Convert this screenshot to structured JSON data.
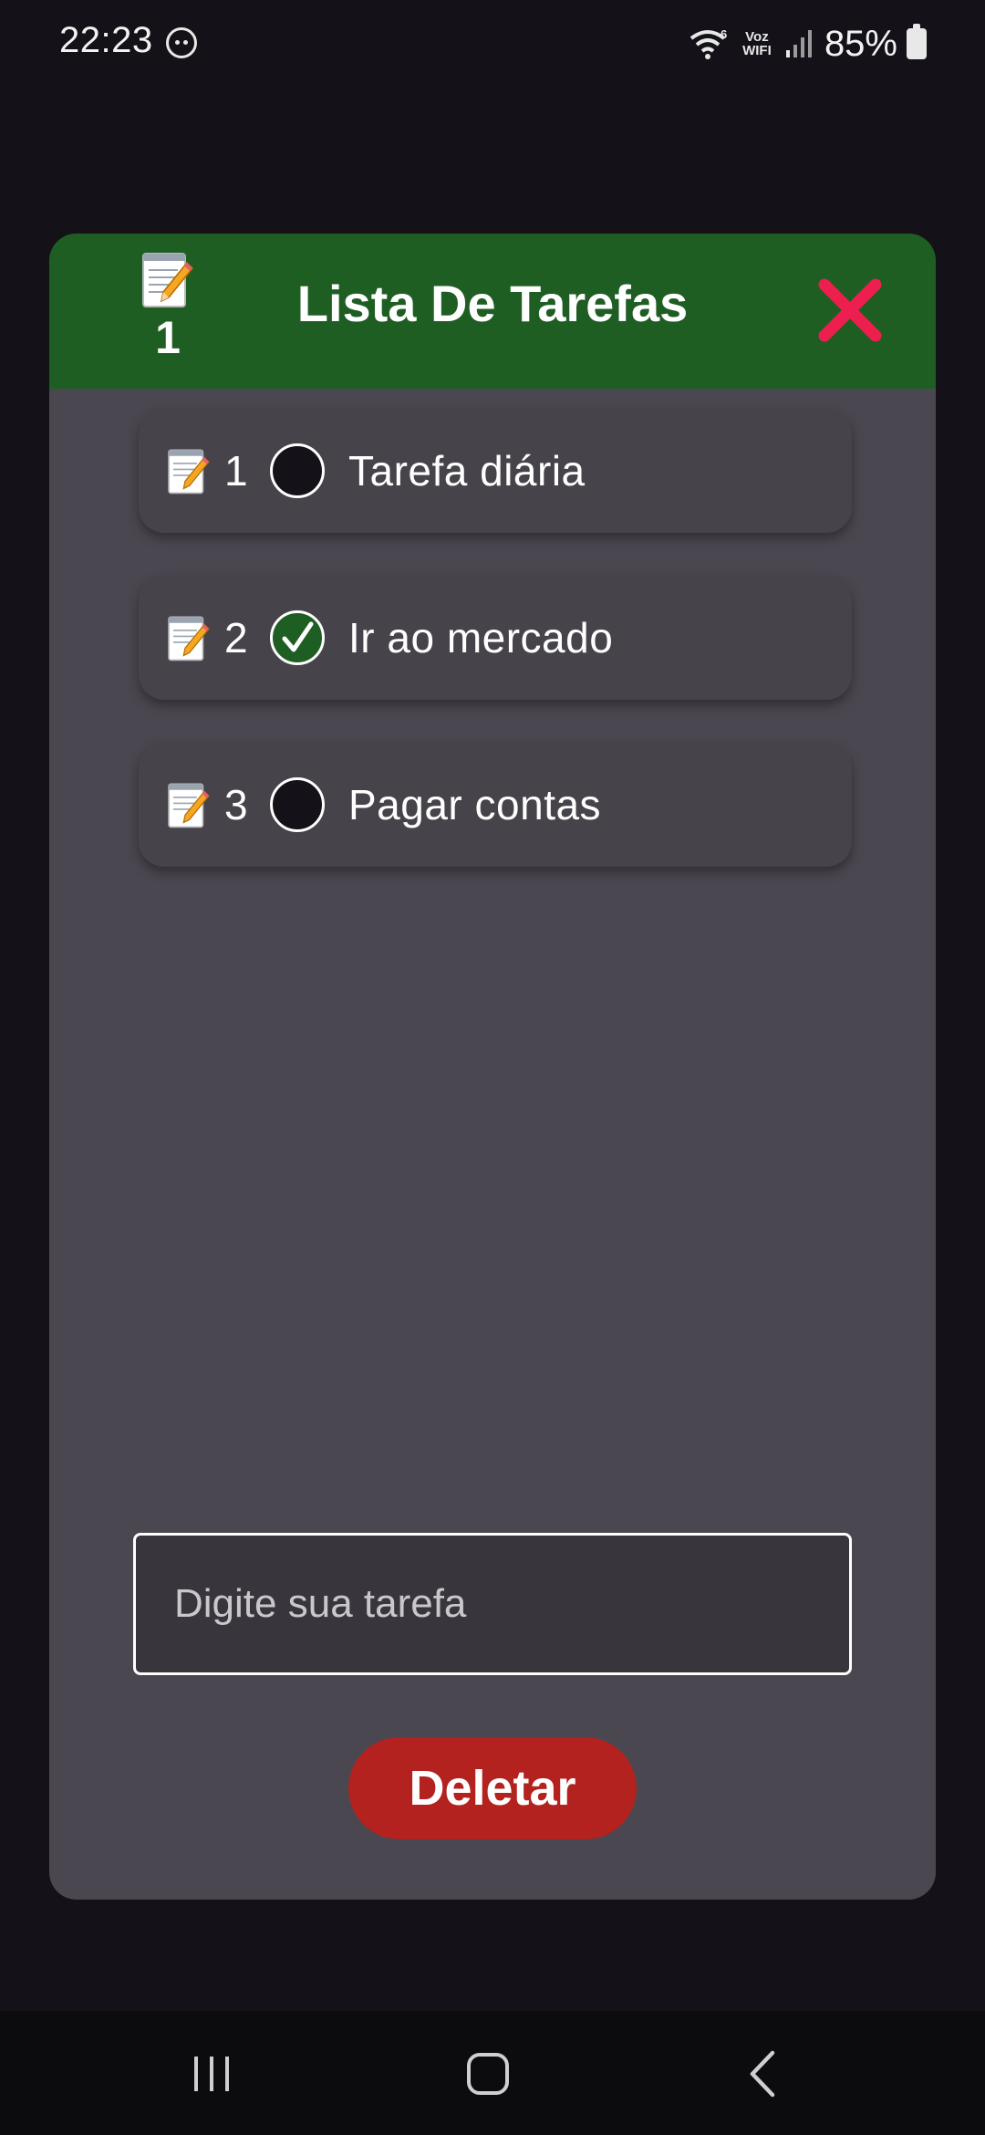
{
  "status_bar": {
    "time": "22:23",
    "voz_label": "Voz",
    "wifi_label": "WIFI",
    "battery": "85%"
  },
  "dialog": {
    "title": "Lista De Tarefas",
    "badge_count": "1",
    "header_color": "#1e5e23"
  },
  "tasks": [
    {
      "index": "1",
      "text": "Tarefa diária",
      "done": false
    },
    {
      "index": "2",
      "text": "Ir ao mercado",
      "done": true
    },
    {
      "index": "3",
      "text": "Pagar contas",
      "done": false
    }
  ],
  "input": {
    "placeholder": "Digite sua tarefa",
    "value": ""
  },
  "delete_button": {
    "label": "Deletar",
    "color": "#b3221f"
  },
  "icons": {
    "memo": "memo-icon",
    "close": "close-icon",
    "check": "checkmark-icon",
    "nav_recents": "recents-icon",
    "nav_home": "home-icon",
    "nav_back": "back-icon"
  }
}
